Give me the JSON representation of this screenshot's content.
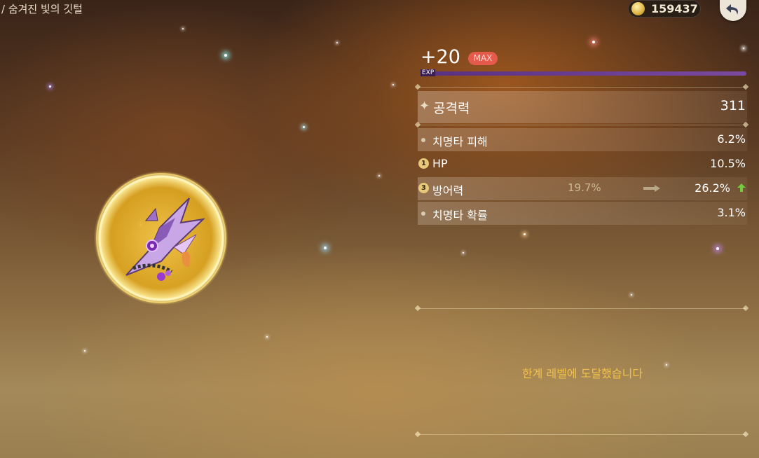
{
  "breadcrumb": "/ 숨겨진 빛의 깃털",
  "currency": {
    "mora": "159437",
    "icon": "mora-coin-icon"
  },
  "back_button": {
    "icon": "return-arrow-icon"
  },
  "artifact": {
    "level": "+20",
    "max_badge": "MAX",
    "exp_label": "EXP",
    "exp_progress": 1.0,
    "main_stat": {
      "name": "공격력",
      "value": "311"
    },
    "sub_stats": [
      {
        "marker": "",
        "name": "치명타 피해",
        "value": "6.2%"
      },
      {
        "marker": "1",
        "name": "HP",
        "value": "10.5%"
      },
      {
        "marker": "3",
        "name": "방어력",
        "old_value": "19.7%",
        "value": "26.2%"
      },
      {
        "marker": "",
        "name": "치명타 확률",
        "value": "3.1%"
      }
    ]
  },
  "limit_message": "한계 레벨에 도달했습니다",
  "colors": {
    "accent_gold": "#f0c04a",
    "max_badge": "#e65a4c",
    "increase": "#6fcf3a"
  }
}
